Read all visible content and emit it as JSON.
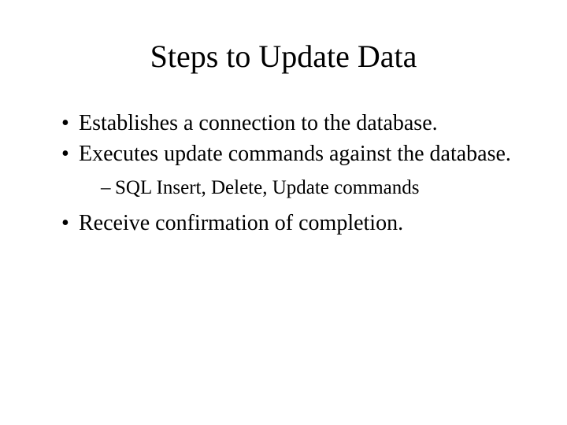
{
  "title": "Steps to Update Data",
  "bullets": [
    "Establishes a connection to the database.",
    "Executes update commands against the database.",
    "Receive confirmation of completion."
  ],
  "sub": [
    "SQL Insert, Delete, Update commands"
  ]
}
